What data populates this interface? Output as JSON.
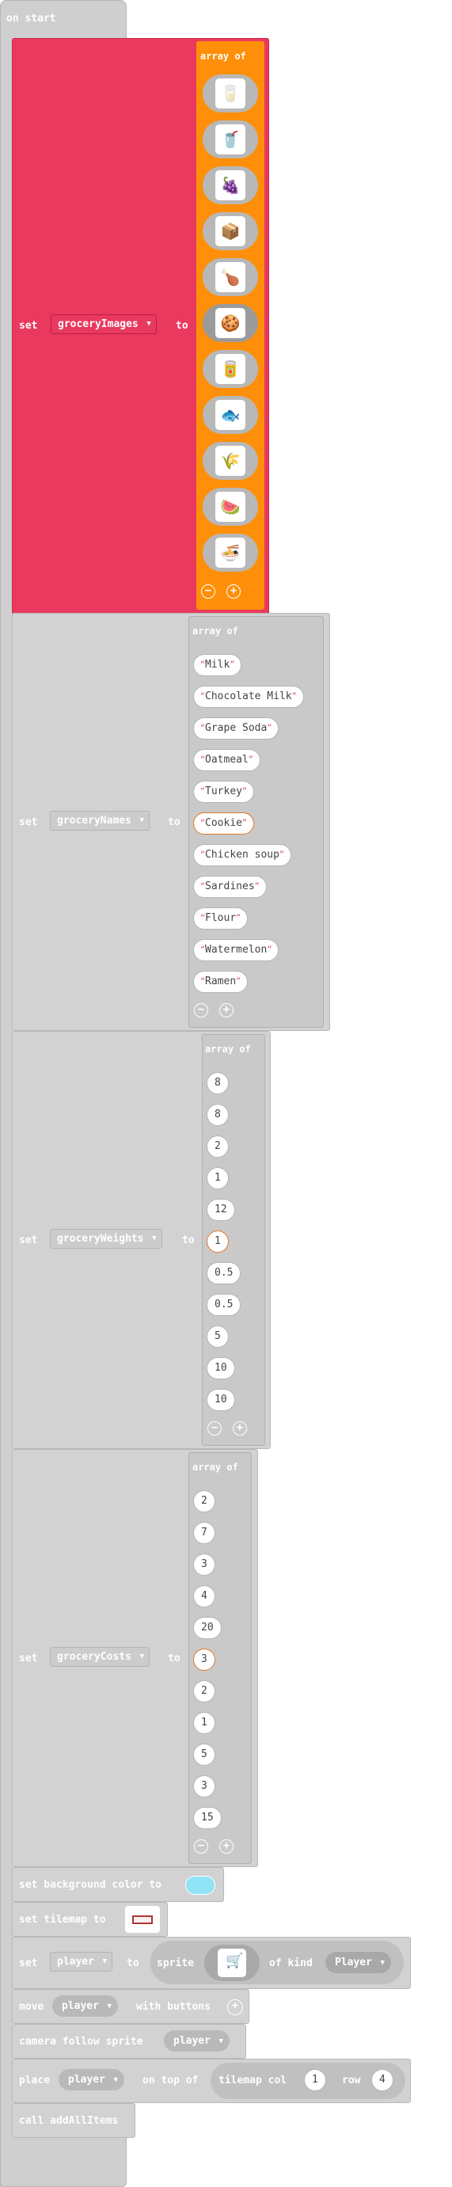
{
  "event": {
    "label": "on start"
  },
  "set_word": "set",
  "to_word": "to",
  "array_of": "array of",
  "block1": {
    "variable": "groceryImages",
    "color": "#e9395e",
    "array_color": "#ff8f08",
    "icons": [
      "milk-carton-icon",
      "chocolate-milk-icon",
      "grape-soda-icon",
      "oatmeal-box-icon",
      "turkey-icon",
      "cookie-icon",
      "chicken-soup-can-icon",
      "sardines-tin-icon",
      "flour-bag-icon",
      "watermelon-icon",
      "ramen-bowl-icon"
    ]
  },
  "block2": {
    "variable": "groceryNames",
    "items": [
      "Milk",
      "Chocolate Milk",
      "Grape Soda",
      "Oatmeal",
      "Turkey",
      "Cookie",
      "Chicken soup",
      "Sardines",
      "Flour",
      "Watermelon",
      "Ramen"
    ]
  },
  "block3": {
    "variable": "groceryWeights",
    "items": [
      "8",
      "8",
      "2",
      "1",
      "12",
      "1",
      "0.5",
      "0.5",
      "5",
      "10",
      "10"
    ]
  },
  "block4": {
    "variable": "groceryCosts",
    "items": [
      "2",
      "7",
      "3",
      "4",
      "20",
      "3",
      "2",
      "1",
      "5",
      "3",
      "15"
    ]
  },
  "bg_block": {
    "label": "set background color to",
    "swatch": "#8fe3f5"
  },
  "tilemap_block": {
    "label": "set tilemap to"
  },
  "sprite_block": {
    "set": "set",
    "variable": "player",
    "to": "to",
    "sprite": "sprite",
    "of_kind": "of kind",
    "kind": "Player"
  },
  "move_block": {
    "move": "move",
    "variable": "player",
    "with_buttons": "with buttons"
  },
  "camera_block": {
    "label": "camera follow sprite",
    "variable": "player"
  },
  "place_block": {
    "place": "place",
    "variable": "player",
    "on_top_of": "on top of",
    "tilemap_col": "tilemap col",
    "col": "1",
    "row_word": "row",
    "row": "4"
  },
  "call_block": {
    "label": "call addAllItems"
  }
}
